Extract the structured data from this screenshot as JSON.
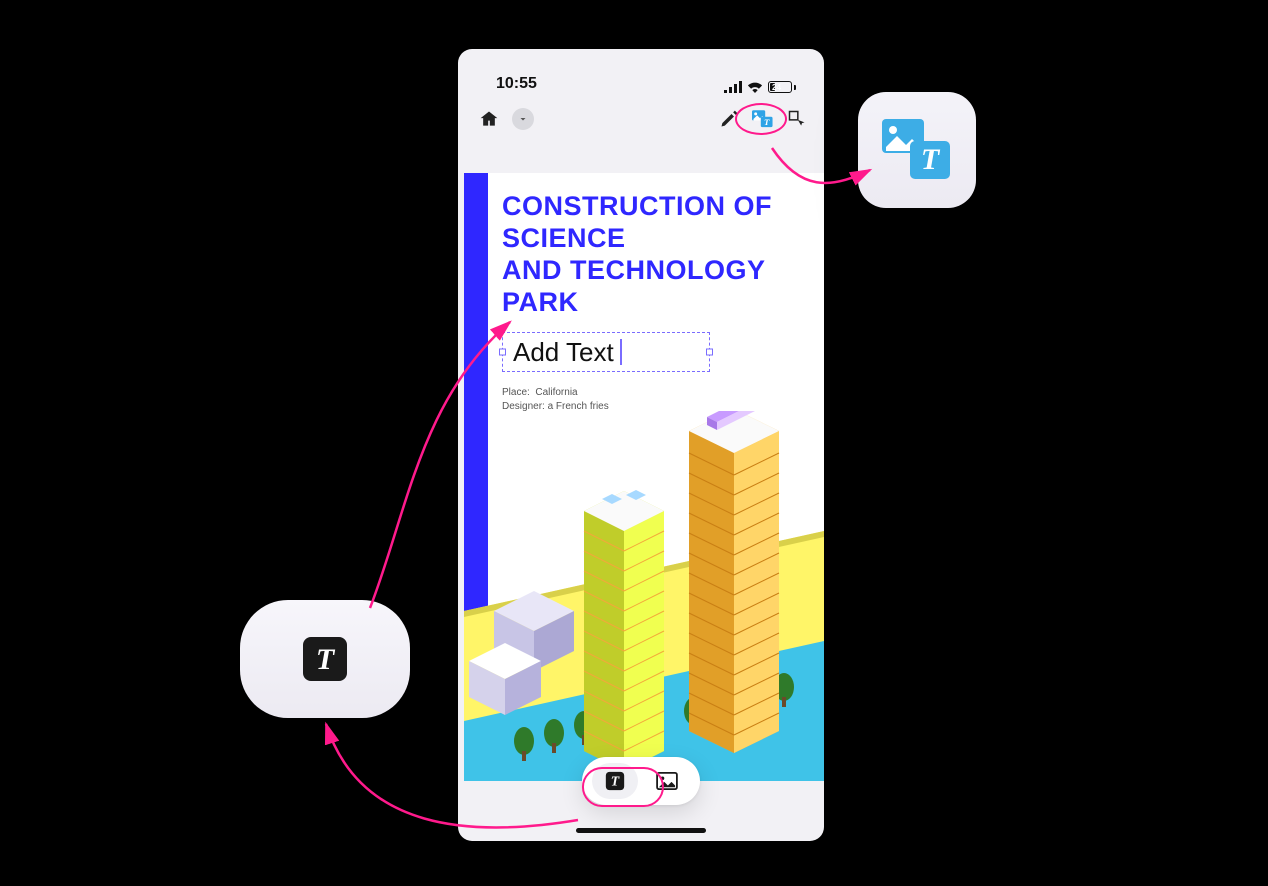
{
  "status": {
    "time": "10:55",
    "battery_pct": "24"
  },
  "toolbar": {
    "icons": {
      "home": "home-icon",
      "dropdown": "chevron-down-icon",
      "highlighter": "highlighter-icon",
      "image_text": "image-text-mode-icon",
      "select": "selection-tool-icon"
    }
  },
  "document": {
    "title_line1": "CONSTRUCTION OF SCIENCE",
    "title_line2": "AND TECHNOLOGY PARK",
    "add_text_label": "Add Text",
    "meta_place_label": "Place:",
    "meta_place_value": "California",
    "meta_designer_label": "Designer:",
    "meta_designer_value": "a French fries"
  },
  "bottom_bar": {
    "text_tool": "text-tool-icon",
    "image_tool": "image-tool-icon"
  },
  "callouts": {
    "right": "image-text-mode-icon-large",
    "left": "text-tool-icon-large"
  }
}
